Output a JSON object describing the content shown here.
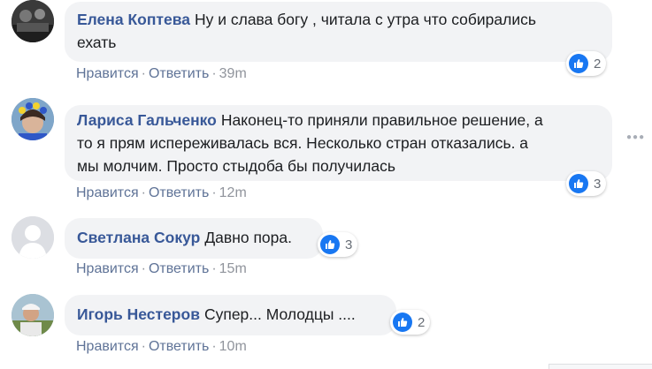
{
  "comments": [
    {
      "author": "Елена Коптева",
      "text_line1": "Ну и слава богу , читала с утра что собирались",
      "text_line2": "ехать",
      "like_label": "Нравится",
      "reply_label": "Ответить",
      "time": "39m",
      "reactions": "2"
    },
    {
      "author": "Лариса Гальченко",
      "text_line1": "Наконец-то приняли правильное решение, а",
      "text_line2": "то я прям испереживалась вся. Несколько стран отказались. а",
      "text_line3": "мы молчим. Просто стыдоба бы получилась",
      "like_label": "Нравится",
      "reply_label": "Ответить",
      "time": "12m",
      "reactions": "3"
    },
    {
      "author": "Светлана Сокур",
      "text_line1": "Давно пора.",
      "like_label": "Нравится",
      "reply_label": "Ответить",
      "time": "15m",
      "reactions": "3"
    },
    {
      "author": "Игорь Нестеров",
      "text_line1": "Супер... Молодцы ....",
      "like_label": "Нравится",
      "reply_label": "Ответить",
      "time": "10m",
      "reactions": "2"
    }
  ],
  "separator": "·",
  "more_options_icon": "ellipsis-icon",
  "reaction_icon": "thumbs-up-icon",
  "colors": {
    "author": "#385898",
    "bubble": "#f2f3f5",
    "like_badge": "#1877f2"
  }
}
